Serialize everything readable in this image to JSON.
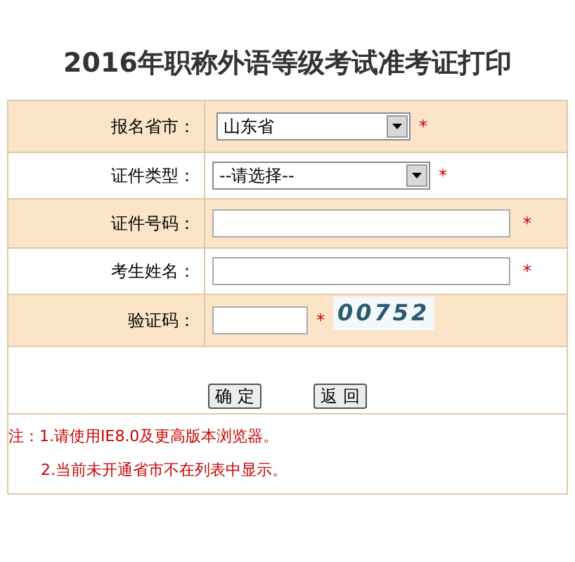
{
  "title": "2016年职称外语等级考试准考证打印",
  "rows": [
    {
      "label": "报名省市：",
      "kind": "select",
      "value": "山东省",
      "required": "*"
    },
    {
      "label": "证件类型：",
      "kind": "select",
      "value": "--请选择--",
      "required": "*"
    },
    {
      "label": "证件号码：",
      "kind": "text",
      "required": "*"
    },
    {
      "label": "考生姓名：",
      "kind": "text",
      "required": "*"
    },
    {
      "label": "验证码：",
      "kind": "captcha",
      "required": "*",
      "captcha": "00752"
    }
  ],
  "buttons": [
    "确 定",
    "返 回"
  ],
  "notes": [
    "注：1.请使用IE8.0及更高版本浏览器。",
    "2.当前未开通省市不在列表中显示。"
  ]
}
